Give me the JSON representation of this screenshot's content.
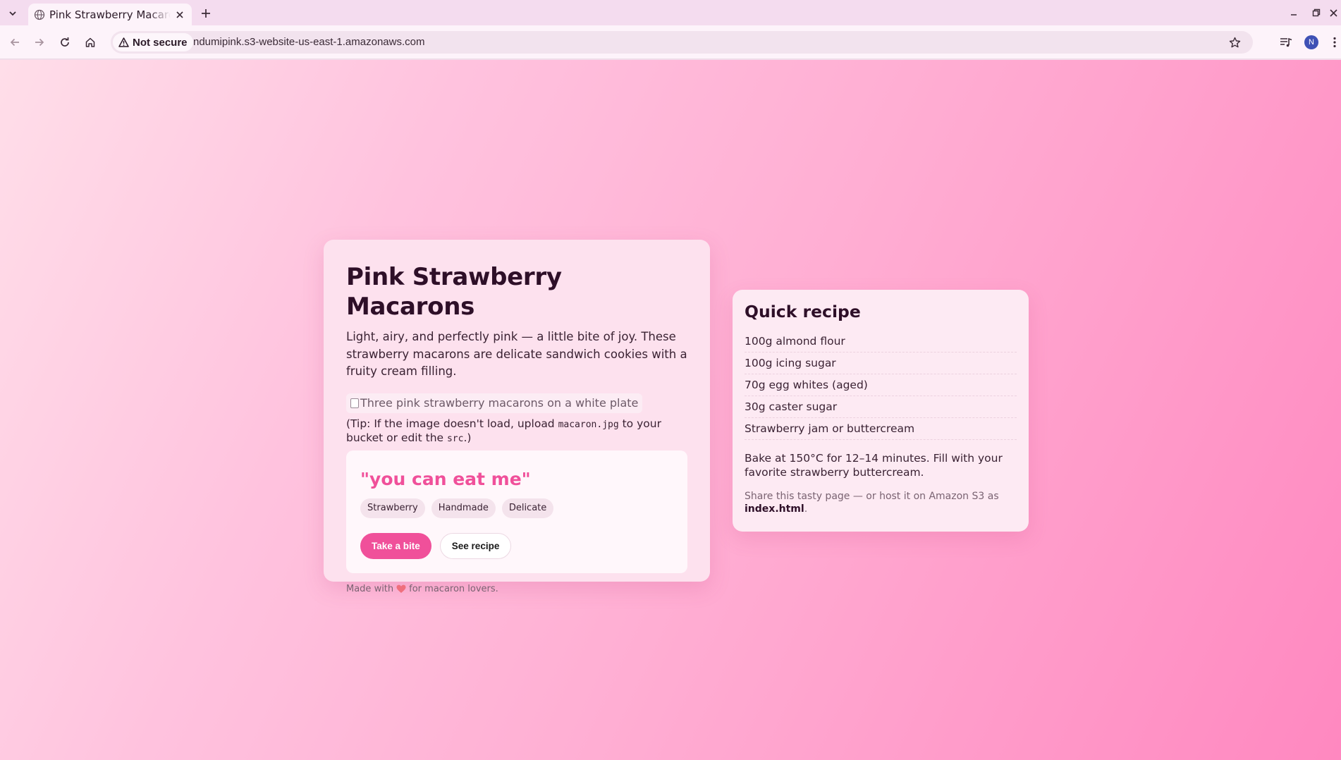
{
  "browser": {
    "tab_title": "Pink Strawberry Macarons",
    "security_label": "Not secure",
    "url": "ndumipink.s3-website-us-east-1.amazonaws.com",
    "profile_initial": "N"
  },
  "hero": {
    "title": "Pink Strawberry Macarons",
    "description": "Light, airy, and perfectly pink — a little bite of joy. These strawberry macarons are delicate sandwich cookies with a fruity cream filling.",
    "image_alt": "Three pink strawberry macarons on a white plate",
    "tip_prefix": "(Tip: If the image doesn't load, upload ",
    "tip_file": "macaron.jpg",
    "tip_middle": " to your bucket or edit the ",
    "tip_attr": "src",
    "tip_suffix": ".)",
    "quote": "\"you can eat me\"",
    "tags": [
      "Strawberry",
      "Handmade",
      "Delicate"
    ],
    "primary_button": "Take a bite",
    "secondary_button": "See recipe",
    "footer_prefix": "Made with",
    "footer_suffix": "for macaron lovers."
  },
  "recipe": {
    "title": "Quick recipe",
    "ingredients": [
      "100g almond flour",
      "100g icing sugar",
      "70g egg whites (aged)",
      "30g caster sugar",
      "Strawberry jam or buttercream"
    ],
    "bake_note": "Bake at 150°C for 12–14 minutes. Fill with your favorite strawberry buttercream.",
    "share_prefix": "Share this tasty page — or host it on Amazon S3 as ",
    "share_file": "index.html",
    "share_suffix": "."
  },
  "colors": {
    "accent": "#f0509a",
    "title_text": "#2e0f28",
    "background_start": "#ffdee9",
    "background_end": "#ff88c0"
  }
}
